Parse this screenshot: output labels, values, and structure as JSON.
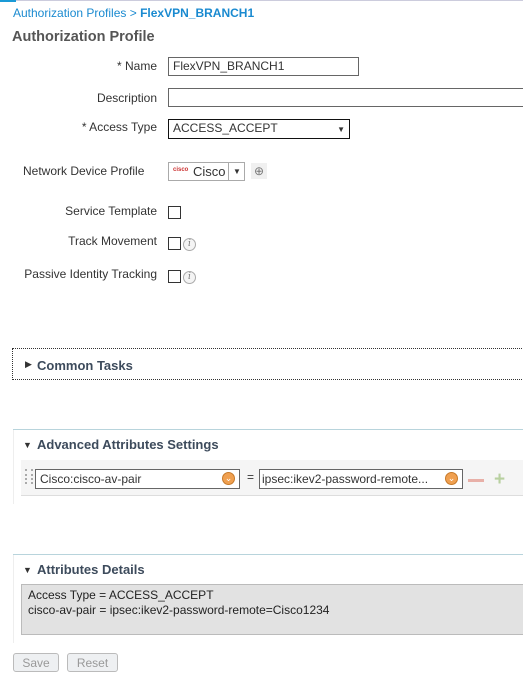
{
  "breadcrumb": {
    "parent": "Authorization Profiles",
    "separator": ">",
    "current": "FlexVPN_BRANCH1"
  },
  "page_title": "Authorization Profile",
  "form": {
    "name_label": "* Name",
    "name_value": "FlexVPN_BRANCH1",
    "description_label": "Description",
    "description_value": "",
    "access_type_label": "* Access Type",
    "access_type_value": "ACCESS_ACCEPT",
    "ndp_label": "Network Device Profile",
    "ndp_value": "Cisco",
    "ndp_logo": "cisco",
    "service_template_label": "Service Template",
    "service_template_checked": false,
    "track_movement_label": "Track Movement",
    "track_movement_checked": false,
    "passive_label": "Passive Identity Tracking",
    "passive_checked": false,
    "info_glyph": "i"
  },
  "common_tasks": {
    "title": "Common Tasks",
    "expanded": false
  },
  "advanced": {
    "title": "Advanced Attributes Settings",
    "attribute": "Cisco:cisco-av-pair",
    "equals": "=",
    "value": "ipsec:ikev2-password-remote..."
  },
  "details": {
    "title": "Attributes Details",
    "lines": [
      "Access Type = ACCESS_ACCEPT",
      "cisco-av-pair = ipsec:ikev2-password-remote=Cisco1234"
    ]
  },
  "buttons": {
    "save": "Save",
    "reset": "Reset"
  },
  "colors": {
    "accent": "#1a8ad0",
    "orange": "#f0a050",
    "details_bg": "#e2e2e2"
  }
}
